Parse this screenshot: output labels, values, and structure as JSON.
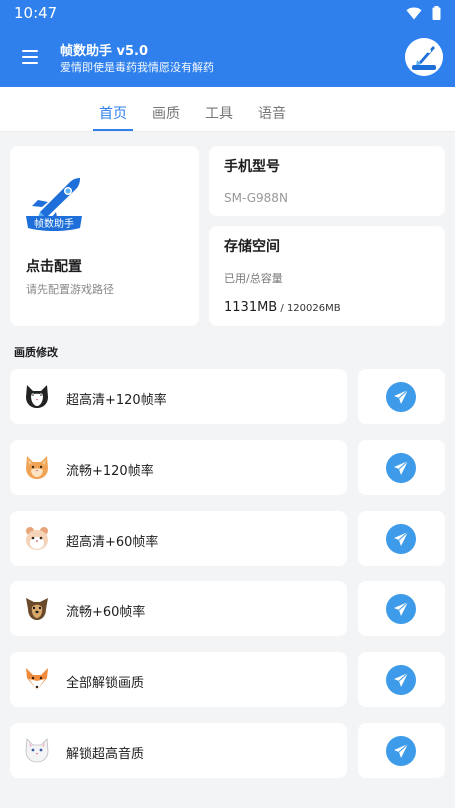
{
  "status_bar": {
    "time": "10:47",
    "wifi_icon": "wifi-icon",
    "battery_icon": "battery-icon"
  },
  "app_bar": {
    "title": "帧数助手 v5.0",
    "subtitle": "爱情即使是毒药我情愿没有解药",
    "menu_icon": "hamburger-menu-icon",
    "logo_icon": "rocket-logo-icon"
  },
  "tabs": [
    "首页",
    "画质",
    "工具",
    "语音"
  ],
  "active_tab": 0,
  "config_card": {
    "logo_text": "帧数助手",
    "title": "点击配置",
    "subtitle": "请先配置游戏路径"
  },
  "model_card": {
    "title": "手机型号",
    "value": "SM-G988N"
  },
  "storage_card": {
    "title": "存储空间",
    "subtitle": "已用/总容量",
    "used": "1131MB",
    "total": " / 120026MB"
  },
  "section_title": "画质修改",
  "quality_items": [
    {
      "label": "超高清+120帧率",
      "icon": "black-cat-icon"
    },
    {
      "label": "流畅+120帧率",
      "icon": "orange-cat-icon"
    },
    {
      "label": "超高清+60帧率",
      "icon": "hamster-icon"
    },
    {
      "label": "流畅+60帧率",
      "icon": "dog-icon"
    },
    {
      "label": "全部解锁画质",
      "icon": "fox-icon"
    },
    {
      "label": "解锁超高音质",
      "icon": "white-cat-icon"
    }
  ],
  "send_icon": "send-icon",
  "colors": {
    "primary": "#2f80ed",
    "send": "#3d9be9",
    "background": "#f3f4f6"
  }
}
